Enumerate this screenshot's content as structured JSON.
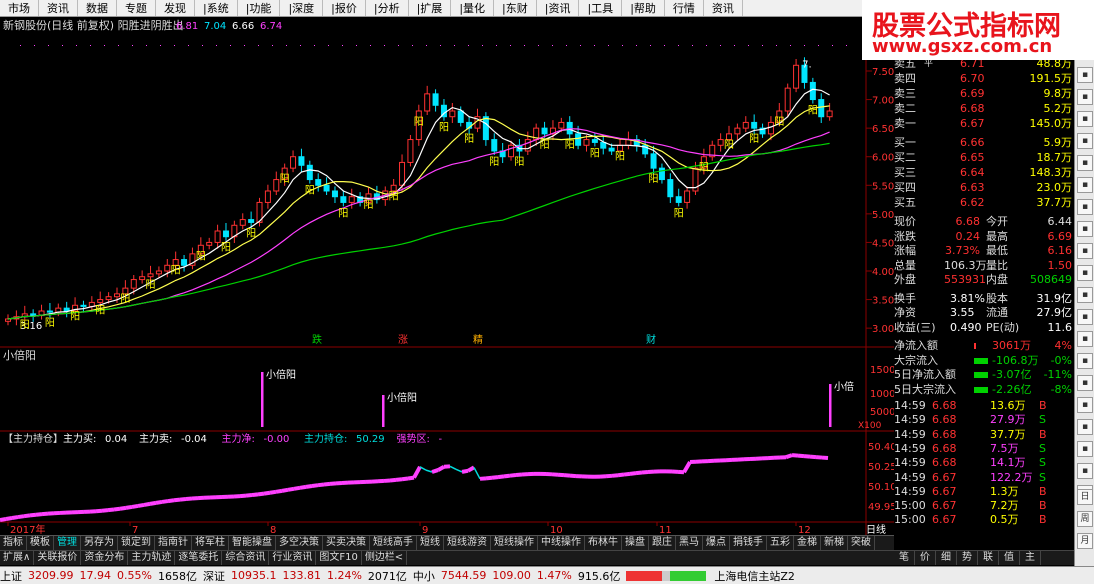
{
  "menu": [
    "市场",
    "资讯",
    "数据",
    "专题",
    "发现",
    "|系统",
    "|功能",
    "|深度",
    "|报价",
    "|分析",
    "|扩展",
    "|量化",
    "|东财",
    "|资讯",
    "|工具",
    "|帮助",
    "行情",
    "资讯"
  ],
  "logo": {
    "title": "股票公式指标网",
    "url": "www.gsxz.com.cn"
  },
  "chart_title": "新钢股份(日线 前复权) 阳胜进阴胜出",
  "chart_title_values": [
    "6.81",
    "7.04",
    "6.66",
    "6.74"
  ],
  "price_axis": [
    "7.50",
    "7.00",
    "6.50",
    "6.00",
    "5.50",
    "5.00",
    "4.50",
    "4.00",
    "3.50",
    "3.00"
  ],
  "low_label": "3.16",
  "high_label": "7.",
  "indicator1": {
    "name": "小倍阳",
    "axis": [
      "15000",
      "10000",
      "5000"
    ],
    "unit": "X100",
    "signal_label": "小倍阳",
    "signal_label_cut": "小倍"
  },
  "indicator2": {
    "name": "【主力持仓】",
    "items": [
      {
        "label": "主力买:",
        "value": "0.04",
        "color": "#ffffff"
      },
      {
        "label": "主力卖:",
        "value": "-0.04",
        "color": "#ffffff"
      },
      {
        "label": "主力净:",
        "value": "-0.00",
        "color": "#ff40ff"
      },
      {
        "label": "主力持仓:",
        "value": "50.29",
        "color": "#00dcdc"
      },
      {
        "label": "强势区:",
        "value": "-",
        "color": "#ff40ff"
      }
    ],
    "axis": [
      "50.40",
      "50.25",
      "50.10",
      "49.95"
    ]
  },
  "events": [
    "跌",
    "涨",
    "精",
    "财"
  ],
  "time_axis": [
    "2017年",
    "7",
    "8",
    "9",
    "10",
    "11",
    "12"
  ],
  "period_label": "日线",
  "candle_label": "阳",
  "quote": {
    "sell": [
      {
        "label": "卖五",
        "flag": "平",
        "price": "6.71",
        "vol": "48.8万"
      },
      {
        "label": "卖四",
        "flag": "",
        "price": "6.70",
        "vol": "191.5万"
      },
      {
        "label": "卖三",
        "flag": "",
        "price": "6.69",
        "vol": "9.8万"
      },
      {
        "label": "卖二",
        "flag": "",
        "price": "6.68",
        "vol": "5.2万"
      },
      {
        "label": "卖一",
        "flag": "",
        "price": "6.67",
        "vol": "145.0万"
      }
    ],
    "buy": [
      {
        "label": "买一",
        "price": "6.66",
        "vol": "5.9万"
      },
      {
        "label": "买二",
        "price": "6.65",
        "vol": "18.7万"
      },
      {
        "label": "买三",
        "price": "6.64",
        "vol": "148.3万"
      },
      {
        "label": "买四",
        "price": "6.63",
        "vol": "23.0万"
      },
      {
        "label": "买五",
        "price": "6.62",
        "vol": "37.7万"
      }
    ],
    "stats": [
      {
        "l1": "现价",
        "v1": "6.68",
        "c1": "red",
        "l2": "今开",
        "v2": "6.44",
        "c2": "wht"
      },
      {
        "l1": "涨跌",
        "v1": "0.24",
        "c1": "red",
        "l2": "最高",
        "v2": "6.69",
        "c2": "red"
      },
      {
        "l1": "涨幅",
        "v1": "3.73%",
        "c1": "red",
        "l2": "最低",
        "v2": "6.16",
        "c2": "red"
      },
      {
        "l1": "总量",
        "v1": "106.3万",
        "c1": "wht",
        "l2": "量比",
        "v2": "1.50",
        "c2": "red"
      },
      {
        "l1": "外盘",
        "v1": "553931",
        "c1": "red",
        "l2": "内盘",
        "v2": "508649",
        "c2": "grn"
      }
    ],
    "stats2": [
      {
        "l1": "换手",
        "v1": "3.81%",
        "l2": "股本",
        "v2": "31.9亿"
      },
      {
        "l1": "净资",
        "v1": "3.55",
        "l2": "流通",
        "v2": "27.9亿"
      },
      {
        "l1": "收益(三)",
        "v1": "0.490",
        "l2": "PE(动)",
        "v2": "11.6"
      }
    ],
    "flows": [
      {
        "label": "净流入额",
        "value": "3061万",
        "pct": "4%",
        "color": "red"
      },
      {
        "label": "大宗流入",
        "value": "-106.8万",
        "pct": "-0%",
        "color": "grn"
      },
      {
        "label": "5日净流入额",
        "value": "-3.07亿",
        "pct": "-11%",
        "color": "grn"
      },
      {
        "label": "5日大宗流入",
        "value": "-2.26亿",
        "pct": "-8%",
        "color": "grn"
      }
    ],
    "ticks": [
      {
        "time": "14:59",
        "price": "6.68",
        "vol": "13.6万",
        "side": "B"
      },
      {
        "time": "14:59",
        "price": "6.68",
        "vol": "27.9万",
        "side": "S"
      },
      {
        "time": "14:59",
        "price": "6.68",
        "vol": "37.7万",
        "side": "B"
      },
      {
        "time": "14:59",
        "price": "6.68",
        "vol": "7.5万",
        "side": "S"
      },
      {
        "time": "14:59",
        "price": "6.68",
        "vol": "14.1万",
        "side": "S"
      },
      {
        "time": "14:59",
        "price": "6.67",
        "vol": "122.2万",
        "side": "S"
      },
      {
        "time": "14:59",
        "price": "6.67",
        "vol": "1.3万",
        "side": "B"
      },
      {
        "time": "15:00",
        "price": "6.67",
        "vol": "7.2万",
        "side": "B"
      },
      {
        "time": "15:00",
        "price": "6.67",
        "vol": "0.5万",
        "side": "B"
      }
    ]
  },
  "tabs1": [
    "指标",
    "模板",
    "管理",
    "另存为",
    "锁定到",
    "指南针",
    "将军柱",
    "智能操盘",
    "多空决策",
    "买卖决策",
    "短线高手",
    "短线",
    "短线游资",
    "短线操作",
    "中线操作",
    "布林牛",
    "操盘",
    "跟庄",
    "黑马",
    "爆点",
    "捐钱手",
    "五彩",
    "金梯",
    "新梯",
    "突破"
  ],
  "tabs2": [
    "扩展∧",
    "关联报价",
    "资金分布",
    "主力轨迹",
    "逐笔委托",
    "综合资讯",
    "行业资讯",
    "图文F10",
    "侧边栏<"
  ],
  "sub_tabs": [
    "笔",
    "价",
    "细",
    "势",
    "联",
    "值",
    "主"
  ],
  "status": [
    {
      "t": "上证",
      "c": "#000"
    },
    {
      "t": "3209.99",
      "c": "#c00000"
    },
    {
      "t": "17.94",
      "c": "#c00000"
    },
    {
      "t": "0.55%",
      "c": "#c00000"
    },
    {
      "t": "1658亿",
      "c": "#000"
    },
    {
      "t": "深证",
      "c": "#000"
    },
    {
      "t": "10935.1",
      "c": "#c00000"
    },
    {
      "t": "133.81",
      "c": "#c00000"
    },
    {
      "t": "1.24%",
      "c": "#c00000"
    },
    {
      "t": "2071亿",
      "c": "#000"
    },
    {
      "t": "中小",
      "c": "#000"
    },
    {
      "t": "7544.59",
      "c": "#c00000"
    },
    {
      "t": "109.00",
      "c": "#c00000"
    },
    {
      "t": "1.47%",
      "c": "#c00000"
    },
    {
      "t": "915.6亿",
      "c": "#000"
    },
    {
      "t": "上海电信主站Z2",
      "c": "#000"
    }
  ],
  "right_toolbar": [
    "日",
    "周",
    "月"
  ],
  "colors": {
    "up": "#ff3232",
    "down": "#00e5ff",
    "ma_fast": "#ffffff",
    "ma_mid": "#ffff50",
    "ma_slow": "#ff40ff",
    "ma_long": "#00d200",
    "grid": "#8b0000"
  }
}
